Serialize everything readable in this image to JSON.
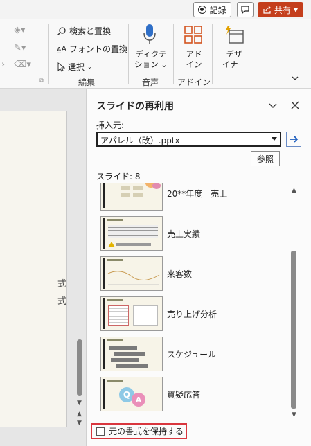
{
  "topbar": {
    "record_label": "記録",
    "share_label": "共有"
  },
  "ribbon": {
    "editing": {
      "find_replace_label": "検索と置換",
      "font_replace_label": "フォントの置換",
      "select_label": "選択",
      "group_label": "編集"
    },
    "voice": {
      "dictate_line1": "ディクテー",
      "dictate_line2": "ション",
      "group_label": "音声"
    },
    "addins": {
      "button_line1": "アド",
      "button_line2": "イン",
      "group_label": "アドイン"
    },
    "designer": {
      "button_line1": "デザ",
      "button_line2": "イナー"
    }
  },
  "slide_preview": {
    "text_lines": [
      "式",
      "式"
    ]
  },
  "reuse_pane": {
    "title": "スライドの再利用",
    "insert_from_label": "挿入元:",
    "file_value": "アパレル（改）.pptx",
    "browse_label": "参照",
    "slide_count_label": "スライド: 8",
    "slides": [
      {
        "label": "20**年度　売上"
      },
      {
        "label": "売上実績"
      },
      {
        "label": "来客数"
      },
      {
        "label": "売り上げ分析"
      },
      {
        "label": "スケジュール"
      },
      {
        "label": "質疑応答"
      }
    ],
    "keep_formatting_label": "元の書式を保持する",
    "keep_formatting_checked": false
  },
  "colors": {
    "share_button": "#c43e1c",
    "dictate_icon": "#2f6fc7",
    "addins_icon": "#d2541e",
    "designer_icon": "#e2a100",
    "highlight_border": "#d9363e"
  }
}
